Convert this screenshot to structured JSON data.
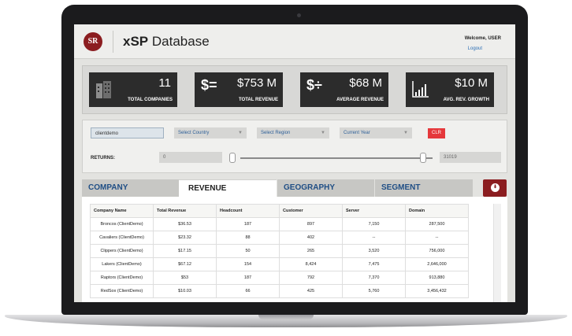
{
  "app": {
    "logo_text": "SR",
    "title_bold": "xSP",
    "title_rest": "Database",
    "welcome": "Welcome, USER",
    "logout": "Logout"
  },
  "stats": [
    {
      "value": "11",
      "label": "TOTAL COMPANIES",
      "icon": "building-icon"
    },
    {
      "value": "$753 M",
      "label": "TOTAL REVENUE",
      "icon": "dollar-equals-icon",
      "glyph": "$="
    },
    {
      "value": "$68 M",
      "label": "AVERAGE REVENUE",
      "icon": "dollar-divide-icon",
      "glyph": "$÷"
    },
    {
      "value": "$10 M",
      "label": "AVG. REV. GROWTH",
      "icon": "growth-chart-icon"
    }
  ],
  "filters": {
    "client": "clientdemo",
    "country": "Select Country",
    "region": "Select Region",
    "year": "Current Year",
    "clear": "CLR",
    "returns_label": "RETURNS:",
    "returns_min": "0",
    "returns_max": "31019"
  },
  "tabs": {
    "company": "COMPANY",
    "revenue": "REVENUE",
    "geography": "GEOGRAPHY",
    "segment": "SEGMENT"
  },
  "table": {
    "headers": [
      "Company Name",
      "Total Revenue",
      "Headcount",
      "Customer",
      "Server",
      "Domain"
    ],
    "rows": [
      [
        "Broncos (ClientDemo)",
        "$36.53",
        "187",
        "897",
        "7,150",
        "287,500"
      ],
      [
        "Cavaliers (ClientDemo)",
        "$23.32",
        "88",
        "402",
        "--",
        "--"
      ],
      [
        "Clippers (ClientDemo)",
        "$17.15",
        "50",
        "265",
        "3,520",
        "756,000"
      ],
      [
        "Lakers (ClientDemo)",
        "$67.12",
        "154",
        "8,424",
        "7,475",
        "2,646,000"
      ],
      [
        "Raptors (ClientDemo)",
        "$53",
        "187",
        "792",
        "7,370",
        "913,880"
      ],
      [
        "RedSox (ClientDemo)",
        "$10.03",
        "66",
        "425",
        "5,760",
        "3,456,432"
      ]
    ]
  },
  "colors": {
    "brand": "#8b1d20",
    "link": "#2d6fb5",
    "tab_text": "#1f4e85",
    "clear_button": "#e5383b",
    "stat_card": "#2c2c2c"
  }
}
